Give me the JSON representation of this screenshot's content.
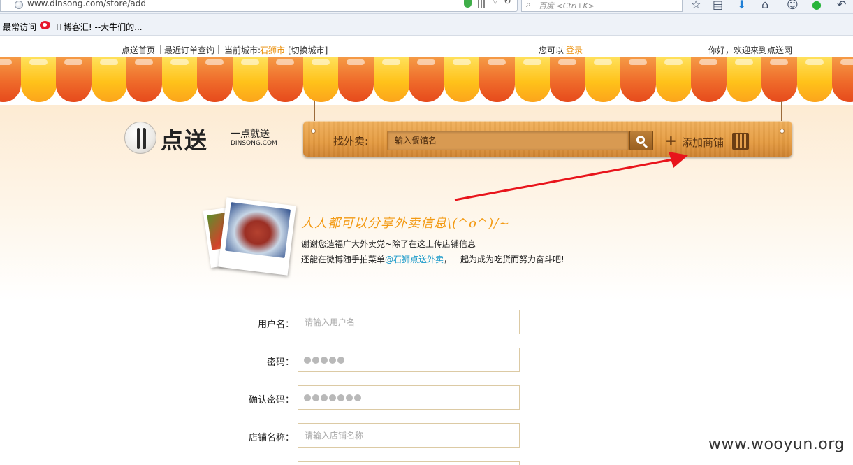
{
  "browser": {
    "url": "www.dinsong.com/store/add",
    "search_placeholder": "百度 <Ctrl+K>",
    "bookmarks": [
      "最常访问",
      "IT博客汇! --大牛们的..."
    ]
  },
  "topbar": {
    "home_link": "点送首页",
    "sep1": "|",
    "recent_orders": "最近订单查询",
    "sep2": "|",
    "current_city_label": "当前城市:",
    "current_city": "石狮市",
    "switch_city": "[切换城市]",
    "login_prefix": "您可以",
    "login_link": "登录",
    "welcome": "你好，欢迎来到点送网"
  },
  "logo": {
    "name": "点送",
    "slogan": "一点就送",
    "domain": "DINSONG.COM"
  },
  "sign": {
    "find_label": "找外卖:",
    "search_placeholder": "输入餐馆名",
    "add_store": "添加商铺"
  },
  "intro": {
    "title": "人人都可以分享外卖信息\\(^o^)/~",
    "line1": "谢谢您造福广大外卖党~除了在这上传店铺信息",
    "line2_before": "还能在微博随手拍菜单",
    "line2_link": "@石狮点送外卖",
    "line2_after": "，一起为成为吃货而努力奋斗吧!"
  },
  "form": {
    "username_label": "用户名：",
    "username_placeholder": "请输入用户名",
    "password_label": "密码：",
    "password_dots": 5,
    "confirm_label": "确认密码：",
    "confirm_dots": 7,
    "store_name_label": "店铺名称：",
    "store_name_placeholder": "请输入店铺名称"
  },
  "watermark": "www.wooyun.org",
  "colors": {
    "accent_orange": "#e98a00",
    "link_blue": "#1b9ac9",
    "awning_red": "#ef6a2a",
    "awning_yellow": "#ffc21a",
    "annotation_arrow": "#e8141b"
  }
}
